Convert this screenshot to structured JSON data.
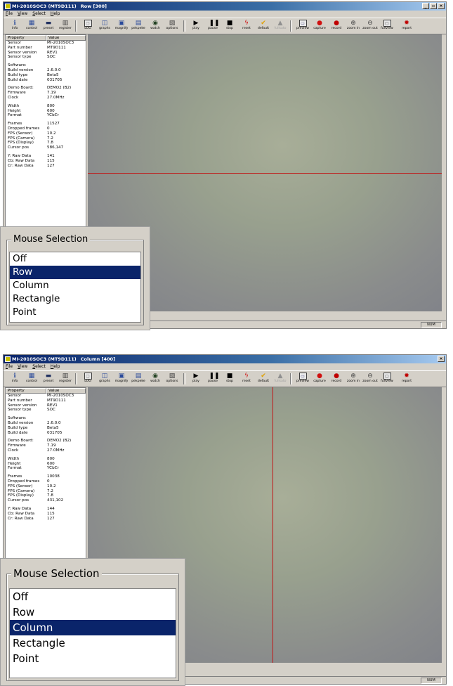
{
  "screens": [
    {
      "title": {
        "app": "MI-2010SOC3 (MT9D111)",
        "mode": "Row [300]"
      },
      "menu": [
        "File",
        "View",
        "Select",
        "Help"
      ],
      "toolbar": [
        {
          "label": "info",
          "icon": "info-icon"
        },
        {
          "label": "control",
          "icon": "control-icon"
        },
        {
          "label": "preset",
          "icon": "save-icon"
        },
        {
          "label": "register",
          "icon": "register-icon"
        },
        {
          "label": "LOG",
          "icon": "log-icon"
        },
        {
          "label": "graphs",
          "icon": "graph-icon"
        },
        {
          "label": "magnify",
          "icon": "magnify-icon"
        },
        {
          "label": "pekpeke",
          "icon": "pixel-peek-icon"
        },
        {
          "label": "watch",
          "icon": "eye-icon"
        },
        {
          "label": "options",
          "icon": "options-icon"
        },
        {
          "label": "play",
          "icon": "play-icon"
        },
        {
          "label": "pause",
          "icon": "pause-icon"
        },
        {
          "label": "stop",
          "icon": "stop-icon"
        },
        {
          "label": "reset",
          "icon": "lightning-icon"
        },
        {
          "label": "default",
          "icon": "checkmark-icon"
        },
        {
          "label": "fullsato",
          "icon": "camera-icon",
          "disabled": true
        },
        {
          "label": "preview",
          "icon": "preview-icon"
        },
        {
          "label": "capture",
          "icon": "capture-icon"
        },
        {
          "label": "record",
          "icon": "record-icon"
        },
        {
          "label": "zoom in",
          "icon": "zoom-in-icon"
        },
        {
          "label": "zoom out",
          "icon": "zoom-out-icon"
        },
        {
          "label": "fullview",
          "icon": "fullview-icon"
        },
        {
          "label": "report",
          "icon": "bug-icon"
        }
      ],
      "props_header": {
        "property": "Property",
        "value": "Value"
      },
      "props": [
        {
          "k": "Sensor",
          "v": "MI-2010SOC3"
        },
        {
          "k": "Part number",
          "v": "MT9D111"
        },
        {
          "k": "Sensor version",
          "v": "REV1"
        },
        {
          "k": "Sensor type",
          "v": "SOC"
        },
        {
          "gap": true
        },
        {
          "k": "Software:",
          "v": ""
        },
        {
          "k": "Build version",
          "v": "2.6.0.0"
        },
        {
          "k": "Build type",
          "v": "Beta5"
        },
        {
          "k": "Build date",
          "v": "031705"
        },
        {
          "gap": true
        },
        {
          "k": "Demo Board:",
          "v": "DEMO2 (B2)"
        },
        {
          "k": "Firmware",
          "v": "7.19"
        },
        {
          "k": "Clock",
          "v": "27.0MHz"
        },
        {
          "gap": true
        },
        {
          "k": "Width",
          "v": "800"
        },
        {
          "k": "Height",
          "v": "600"
        },
        {
          "k": "Format",
          "v": "YCbCr"
        },
        {
          "gap": true
        },
        {
          "k": "Frames",
          "v": "11527"
        },
        {
          "k": "Dropped frames",
          "v": "0"
        },
        {
          "k": "FPS (Sensor)",
          "v": "10.2"
        },
        {
          "k": "FPS (Camera)",
          "v": "7.2"
        },
        {
          "k": "FPS (Display)",
          "v": "7.8"
        },
        {
          "k": "Cursor pos",
          "v": "586,147"
        },
        {
          "gap": true
        },
        {
          "k": "Y: Raw Data",
          "v": "141"
        },
        {
          "k": "Cb: Raw Data",
          "v": "115"
        },
        {
          "k": "Cr: Raw Data",
          "v": "127"
        }
      ],
      "status_num": "NUM",
      "dialog": {
        "title": "Mouse Selection",
        "options": [
          "Off",
          "Row",
          "Column",
          "Rectangle",
          "Point"
        ],
        "selected": "Row"
      }
    },
    {
      "title": {
        "app": "MI-2010SOC3 (MT9D111)",
        "mode": "Column [400]"
      },
      "menu": [
        "File",
        "View",
        "Select",
        "Help"
      ],
      "toolbar": [
        {
          "label": "info",
          "icon": "info-icon"
        },
        {
          "label": "control",
          "icon": "control-icon"
        },
        {
          "label": "preset",
          "icon": "save-icon"
        },
        {
          "label": "register",
          "icon": "register-icon"
        },
        {
          "label": "LOG",
          "icon": "log-icon"
        },
        {
          "label": "graphs",
          "icon": "graph-icon"
        },
        {
          "label": "magnify",
          "icon": "magnify-icon"
        },
        {
          "label": "pekpeke",
          "icon": "pixel-peek-icon"
        },
        {
          "label": "watch",
          "icon": "eye-icon"
        },
        {
          "label": "options",
          "icon": "options-icon"
        },
        {
          "label": "play",
          "icon": "play-icon"
        },
        {
          "label": "pause",
          "icon": "pause-icon"
        },
        {
          "label": "stop",
          "icon": "stop-icon"
        },
        {
          "label": "reset",
          "icon": "lightning-icon"
        },
        {
          "label": "default",
          "icon": "checkmark-icon"
        },
        {
          "label": "fullsato",
          "icon": "camera-icon",
          "disabled": true
        },
        {
          "label": "preview",
          "icon": "preview-icon"
        },
        {
          "label": "capture",
          "icon": "capture-icon"
        },
        {
          "label": "record",
          "icon": "record-icon"
        },
        {
          "label": "zoom in",
          "icon": "zoom-in-icon"
        },
        {
          "label": "zoom out",
          "icon": "zoom-out-icon"
        },
        {
          "label": "fullview",
          "icon": "fullview-icon"
        },
        {
          "label": "report",
          "icon": "bug-icon"
        }
      ],
      "props_header": {
        "property": "Property",
        "value": "Value"
      },
      "props": [
        {
          "k": "Sensor",
          "v": "MI-2010SOC3"
        },
        {
          "k": "Part number",
          "v": "MT9D111"
        },
        {
          "k": "Sensor version",
          "v": "REV1"
        },
        {
          "k": "Sensor type",
          "v": "SOC"
        },
        {
          "gap": true
        },
        {
          "k": "Software:",
          "v": ""
        },
        {
          "k": "Build version",
          "v": "2.6.0.0"
        },
        {
          "k": "Build type",
          "v": "Beta5"
        },
        {
          "k": "Build date",
          "v": "031705"
        },
        {
          "gap": true
        },
        {
          "k": "Demo Board:",
          "v": "DEMO2 (B2)"
        },
        {
          "k": "Firmware",
          "v": "7.19"
        },
        {
          "k": "Clock",
          "v": "27.0MHz"
        },
        {
          "gap": true
        },
        {
          "k": "Width",
          "v": "800"
        },
        {
          "k": "Height",
          "v": "600"
        },
        {
          "k": "Format",
          "v": "YCbCr"
        },
        {
          "gap": true
        },
        {
          "k": "Frames",
          "v": "10038"
        },
        {
          "k": "Dropped frames",
          "v": "0"
        },
        {
          "k": "FPS (Sensor)",
          "v": "10.2"
        },
        {
          "k": "FPS (Camera)",
          "v": "7.2"
        },
        {
          "k": "FPS (Display)",
          "v": "7.8"
        },
        {
          "k": "Cursor pos",
          "v": "431,102"
        },
        {
          "gap": true
        },
        {
          "k": "Y: Raw Data",
          "v": "144"
        },
        {
          "k": "Cb: Raw Data",
          "v": "115"
        },
        {
          "k": "Cr: Raw Data",
          "v": "127"
        }
      ],
      "status_num": "NUM",
      "dialog": {
        "title": "Mouse Selection",
        "options": [
          "Off",
          "Row",
          "Column",
          "Rectangle",
          "Point"
        ],
        "selected": "Column"
      }
    }
  ]
}
